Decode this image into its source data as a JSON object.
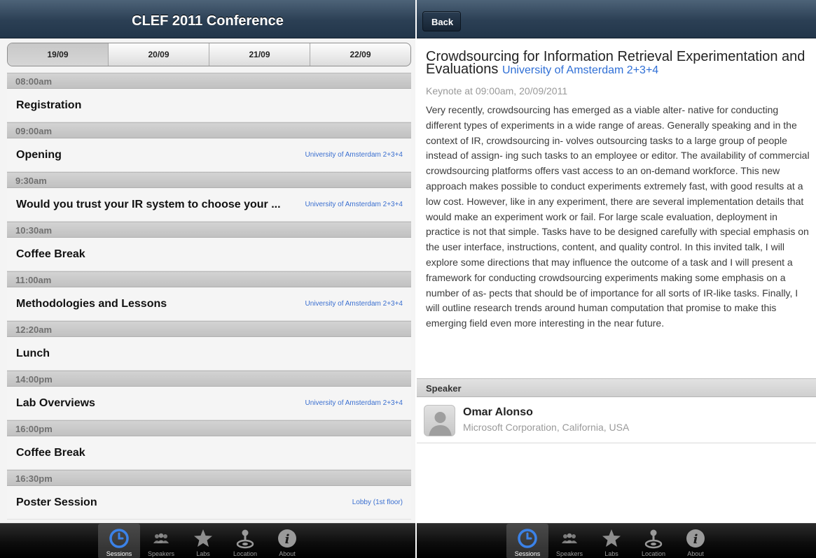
{
  "left": {
    "header": {
      "title": "CLEF 2011 Conference"
    },
    "date_tabs": [
      {
        "label": "19/09",
        "active": true
      },
      {
        "label": "20/09",
        "active": false
      },
      {
        "label": "21/09",
        "active": false
      },
      {
        "label": "22/09",
        "active": false
      }
    ],
    "sessions": [
      {
        "time": "08:00am",
        "title": "Registration",
        "location": ""
      },
      {
        "time": "09:00am",
        "title": "Opening",
        "location": "University of Amsterdam 2+3+4"
      },
      {
        "time": "9:30am",
        "title": "Would you trust your IR system to choose your ...",
        "location": "University of Amsterdam 2+3+4"
      },
      {
        "time": "10:30am",
        "title": "Coffee Break",
        "location": ""
      },
      {
        "time": "11:00am",
        "title": "Methodologies and Lessons",
        "location": "University of Amsterdam 2+3+4"
      },
      {
        "time": "12:20am",
        "title": "Lunch",
        "location": ""
      },
      {
        "time": "14:00pm",
        "title": "Lab Overviews",
        "location": "University of Amsterdam 2+3+4"
      },
      {
        "time": "16:00pm",
        "title": "Coffee Break",
        "location": ""
      },
      {
        "time": "16:30pm",
        "title": "Poster Session",
        "location": "Lobby (1st floor)"
      }
    ]
  },
  "tabbar": [
    {
      "label": "Sessions",
      "icon": "clock-icon",
      "active": true
    },
    {
      "label": "Speakers",
      "icon": "people-icon",
      "active": false
    },
    {
      "label": "Labs",
      "icon": "star-icon",
      "active": false
    },
    {
      "label": "Location",
      "icon": "location-icon",
      "active": false
    },
    {
      "label": "About",
      "icon": "info-icon",
      "active": false
    }
  ],
  "right": {
    "header": {
      "back_label": "Back"
    },
    "detail": {
      "title": "Crowdsourcing for Information Retrieval Experimentation and Evaluations",
      "room": "University of Amsterdam 2+3+4",
      "meta": "Keynote at 09:00am, 20/09/2011",
      "abstract": "Very recently, crowdsourcing has emerged as a viable alter- native for conducting different types of experiments in a wide range of areas. Generally speaking and in the context of IR, crowdsourcing in- volves outsourcing tasks to a large group of people instead of assign- ing such tasks to an employee or editor. The availability of commercial crowdsourcing platforms offers vast access to an on-demand workforce. This new approach makes possible to conduct experiments extremely fast, with good results at a low cost. However, like in any experiment, there are several implementation details that would make an experiment work or fail. For large scale evaluation, deployment in practice is not that simple. Tasks have to be designed carefully with special emphasis on the user interface, instructions, content, and quality control. In this invited talk, I will explore some directions that may influence the outcome of a task and I will present a framework for conducting crowdsourcing experiments making some emphasis on a number of as- pects that should be of importance for all sorts of IR-like tasks. Finally, I will outline research trends around human computation that promise to make this emerging field even more interesting in the near future."
    },
    "speaker_section": {
      "heading": "Speaker"
    },
    "speaker": {
      "name": "Omar Alonso",
      "affiliation": "Microsoft Corporation, California, USA"
    }
  },
  "colors": {
    "header_top": "#4d6378",
    "header_bottom": "#22364a",
    "link_blue": "#3a6fd0",
    "active_icon_blue": "#3b82e8"
  }
}
